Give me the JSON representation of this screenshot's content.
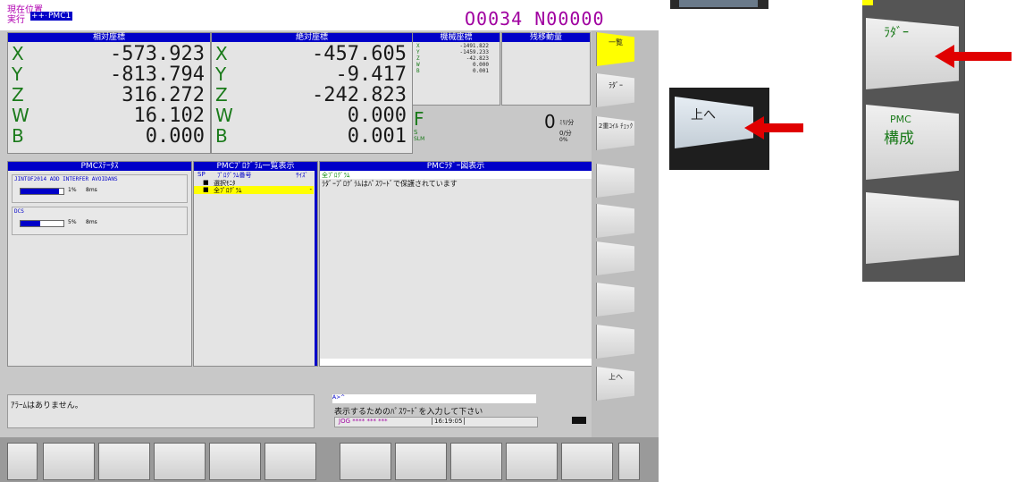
{
  "header": {
    "mode_label": "現在位置",
    "status_label": "実行",
    "status_badge": "+++",
    "path_badge": "PMC1",
    "program_number": "O0034 N00000"
  },
  "relative": {
    "title": "相対座標",
    "axes": [
      {
        "name": "X",
        "value": "-573.923"
      },
      {
        "name": "Y",
        "value": "-813.794"
      },
      {
        "name": "Z",
        "value": "316.272"
      },
      {
        "name": "W",
        "value": "16.102"
      },
      {
        "name": "B",
        "value": "0.000"
      }
    ]
  },
  "absolute": {
    "title": "絶対座標",
    "axes": [
      {
        "name": "X",
        "value": "-457.605"
      },
      {
        "name": "Y",
        "value": "-9.417"
      },
      {
        "name": "Z",
        "value": "-242.823"
      },
      {
        "name": "W",
        "value": "0.000"
      },
      {
        "name": "B",
        "value": "0.001"
      }
    ]
  },
  "machine": {
    "title": "機械座標",
    "axes": [
      {
        "name": "X",
        "value": "-1491.822"
      },
      {
        "name": "Y",
        "value": "-1459.233"
      },
      {
        "name": "Z",
        "value": "-42.823"
      },
      {
        "name": "W",
        "value": "0.000"
      },
      {
        "name": "B",
        "value": "0.001"
      }
    ]
  },
  "remaining": {
    "title": "残移動量"
  },
  "feed": {
    "f_label": "F",
    "s_label": "S",
    "slm_label": "SLM",
    "f_value": "0",
    "f_unit": "ﾐﾘ/分",
    "s_value": "0/分",
    "load": "0%"
  },
  "status_panel": {
    "title": "PMCｽﾃｰﾀｽ",
    "items": [
      {
        "name": "JINTOF2014 ADD INTERFER AVOIDANS",
        "percent": "1%",
        "time": "8ms",
        "fill": 0.3
      },
      {
        "name": "DCS",
        "percent": "5%",
        "time": "8ms",
        "fill": 0.15
      }
    ]
  },
  "program_list": {
    "title": "PMCﾌﾟﾛｸﾞﾗﾑ一覧表示",
    "col_sp": "SP",
    "col_number": "ﾌﾟﾛｸﾞﾗﾑ番号",
    "col_size": "ｻｲｽﾞ",
    "rows": [
      {
        "mark": "■",
        "label": "選択ﾓﾆﾀ"
      },
      {
        "mark": "■",
        "label": "全ﾌﾟﾛｸﾞﾗﾑ"
      }
    ]
  },
  "ladder": {
    "title": "PMCﾗﾀﾞｰ図表示",
    "program": "全ﾌﾟﾛｸﾞﾗﾑ",
    "message": "ﾗﾀﾞｰﾌﾟﾛｸﾞﾗﾑはﾊﾟｽﾜｰﾄﾞで保護されています"
  },
  "alarm": {
    "text": "ｱﾗｰﾑはありません。"
  },
  "prompt": {
    "input_label": "A>^",
    "message": "表示するためのﾊﾟｽﾜｰﾄﾞを入力して下さい",
    "mode": "JOG **** *** ***",
    "time": "16:19:05"
  },
  "softkeys": {
    "list": "一覧",
    "ladder": "ﾗﾀﾞｰ",
    "dual_coil": "2重ｺｲﾙ ﾁｪｯｸ",
    "up": "上へ"
  },
  "zoom_up": {
    "label": "上へ"
  },
  "zoom_side": {
    "ladder": "ﾗﾀﾞｰ",
    "pmc_line1": "PMC",
    "pmc_line2": "構成"
  },
  "colors": {
    "accent_blue": "#0000c8",
    "highlight_yellow": "#ffff00",
    "arrow_red": "#e00000",
    "axis_green": "#1a7a1a"
  }
}
